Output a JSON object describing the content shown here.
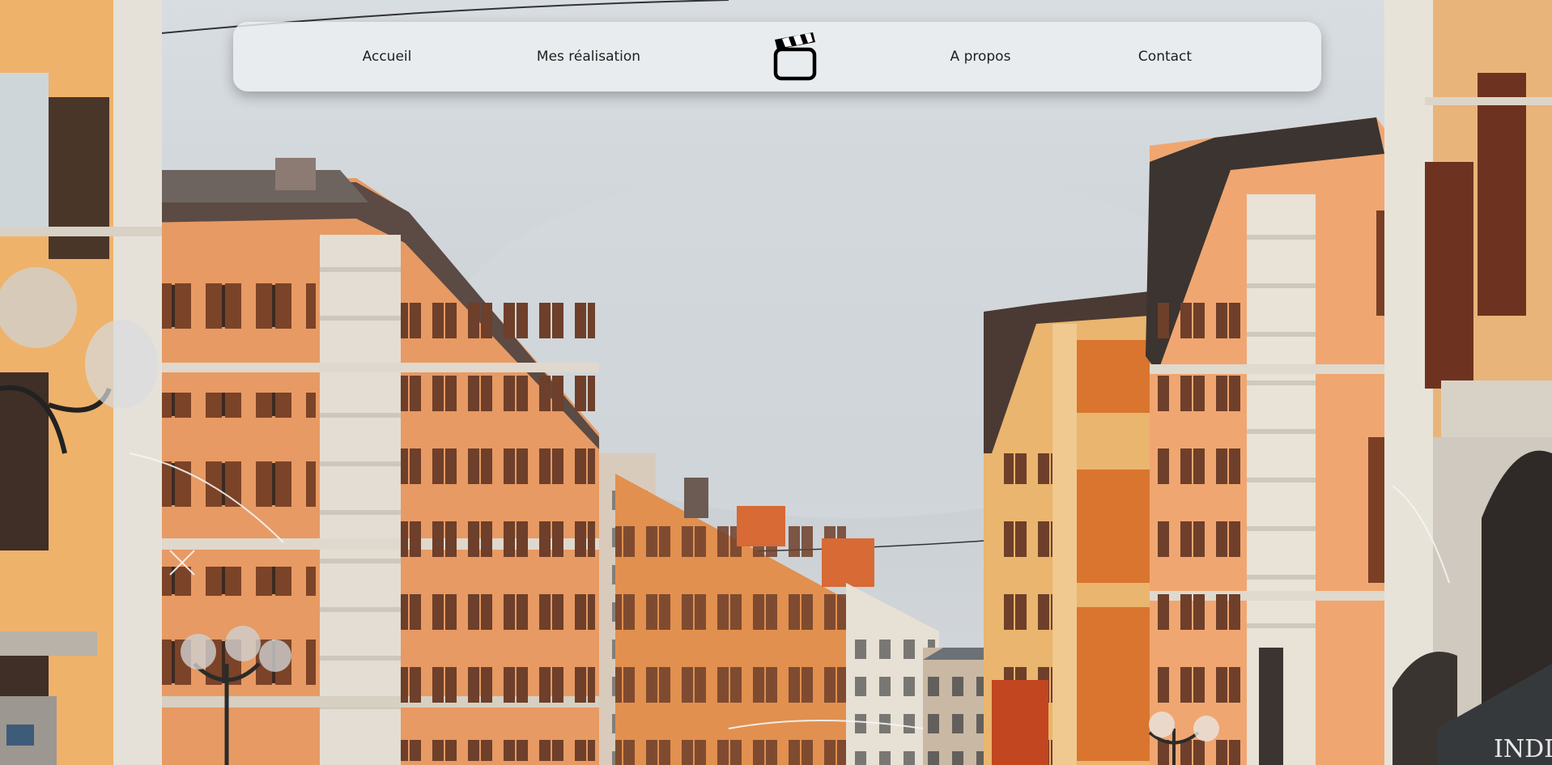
{
  "nav": {
    "items": [
      {
        "label": "Accueil"
      },
      {
        "label": "Mes réalisation"
      },
      {
        "label": "A propos"
      },
      {
        "label": "Contact"
      }
    ],
    "logo_icon": "clapperboard-icon"
  },
  "hero": {
    "shop_sign": "INDIG"
  },
  "colors": {
    "nav_background": "#eceff2",
    "nav_text": "#1f1f1f",
    "sky": "#c9cfd4",
    "facade_orange": "#e39a62",
    "shutter_brown": "#8a4a2e",
    "stone": "#d9d2c6"
  }
}
